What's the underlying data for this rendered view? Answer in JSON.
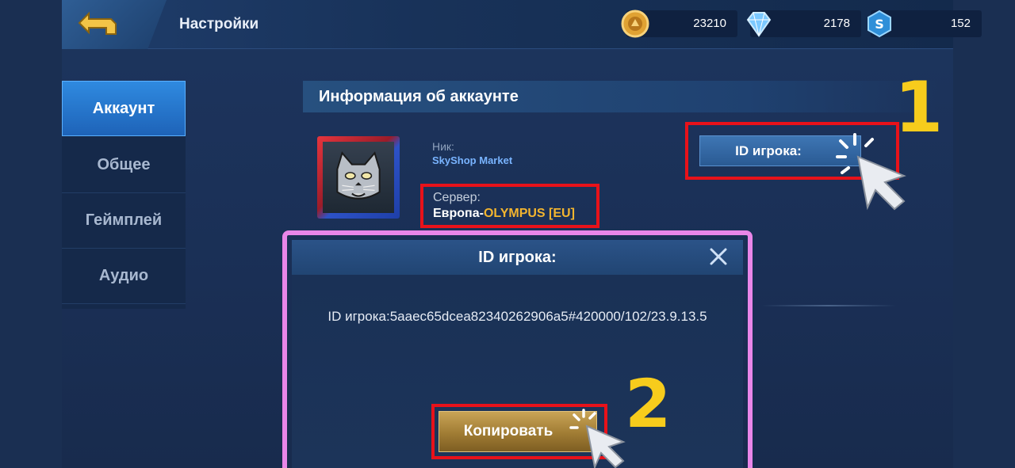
{
  "header": {
    "title": "Настройки",
    "currencies": [
      {
        "name": "gold",
        "icon": "gold-coin-icon",
        "value": "23210"
      },
      {
        "name": "diamonds",
        "icon": "diamond-icon",
        "value": "2178"
      },
      {
        "name": "tickets",
        "icon": "ticket-icon",
        "value": "152"
      }
    ]
  },
  "sidebar": {
    "items": [
      {
        "label": "Аккаунт",
        "active": true
      },
      {
        "label": "Общее",
        "active": false
      },
      {
        "label": "Геймплей",
        "active": false
      },
      {
        "label": "Аудио",
        "active": false
      }
    ]
  },
  "account": {
    "section_title": "Информация об аккаунте",
    "nick_label": "Ник:",
    "nick_value": "SkyShop Market",
    "server_label": "Сервер:",
    "server_region": "Европа-",
    "server_name": "OLYMPUS [EU]",
    "player_id_button": "ID игрока:"
  },
  "annotations": {
    "step1": "1",
    "step2": "2",
    "highlight_color": "#e8121a",
    "dialog_highlight_color": "#e986e9",
    "step_color": "#f7cc1c"
  },
  "dialog": {
    "title": "ID игрока:",
    "body_text": "ID игрока:5aaec65dcea82340262906a5#420000/102/23.9.13.5",
    "copy_button": "Копировать"
  }
}
